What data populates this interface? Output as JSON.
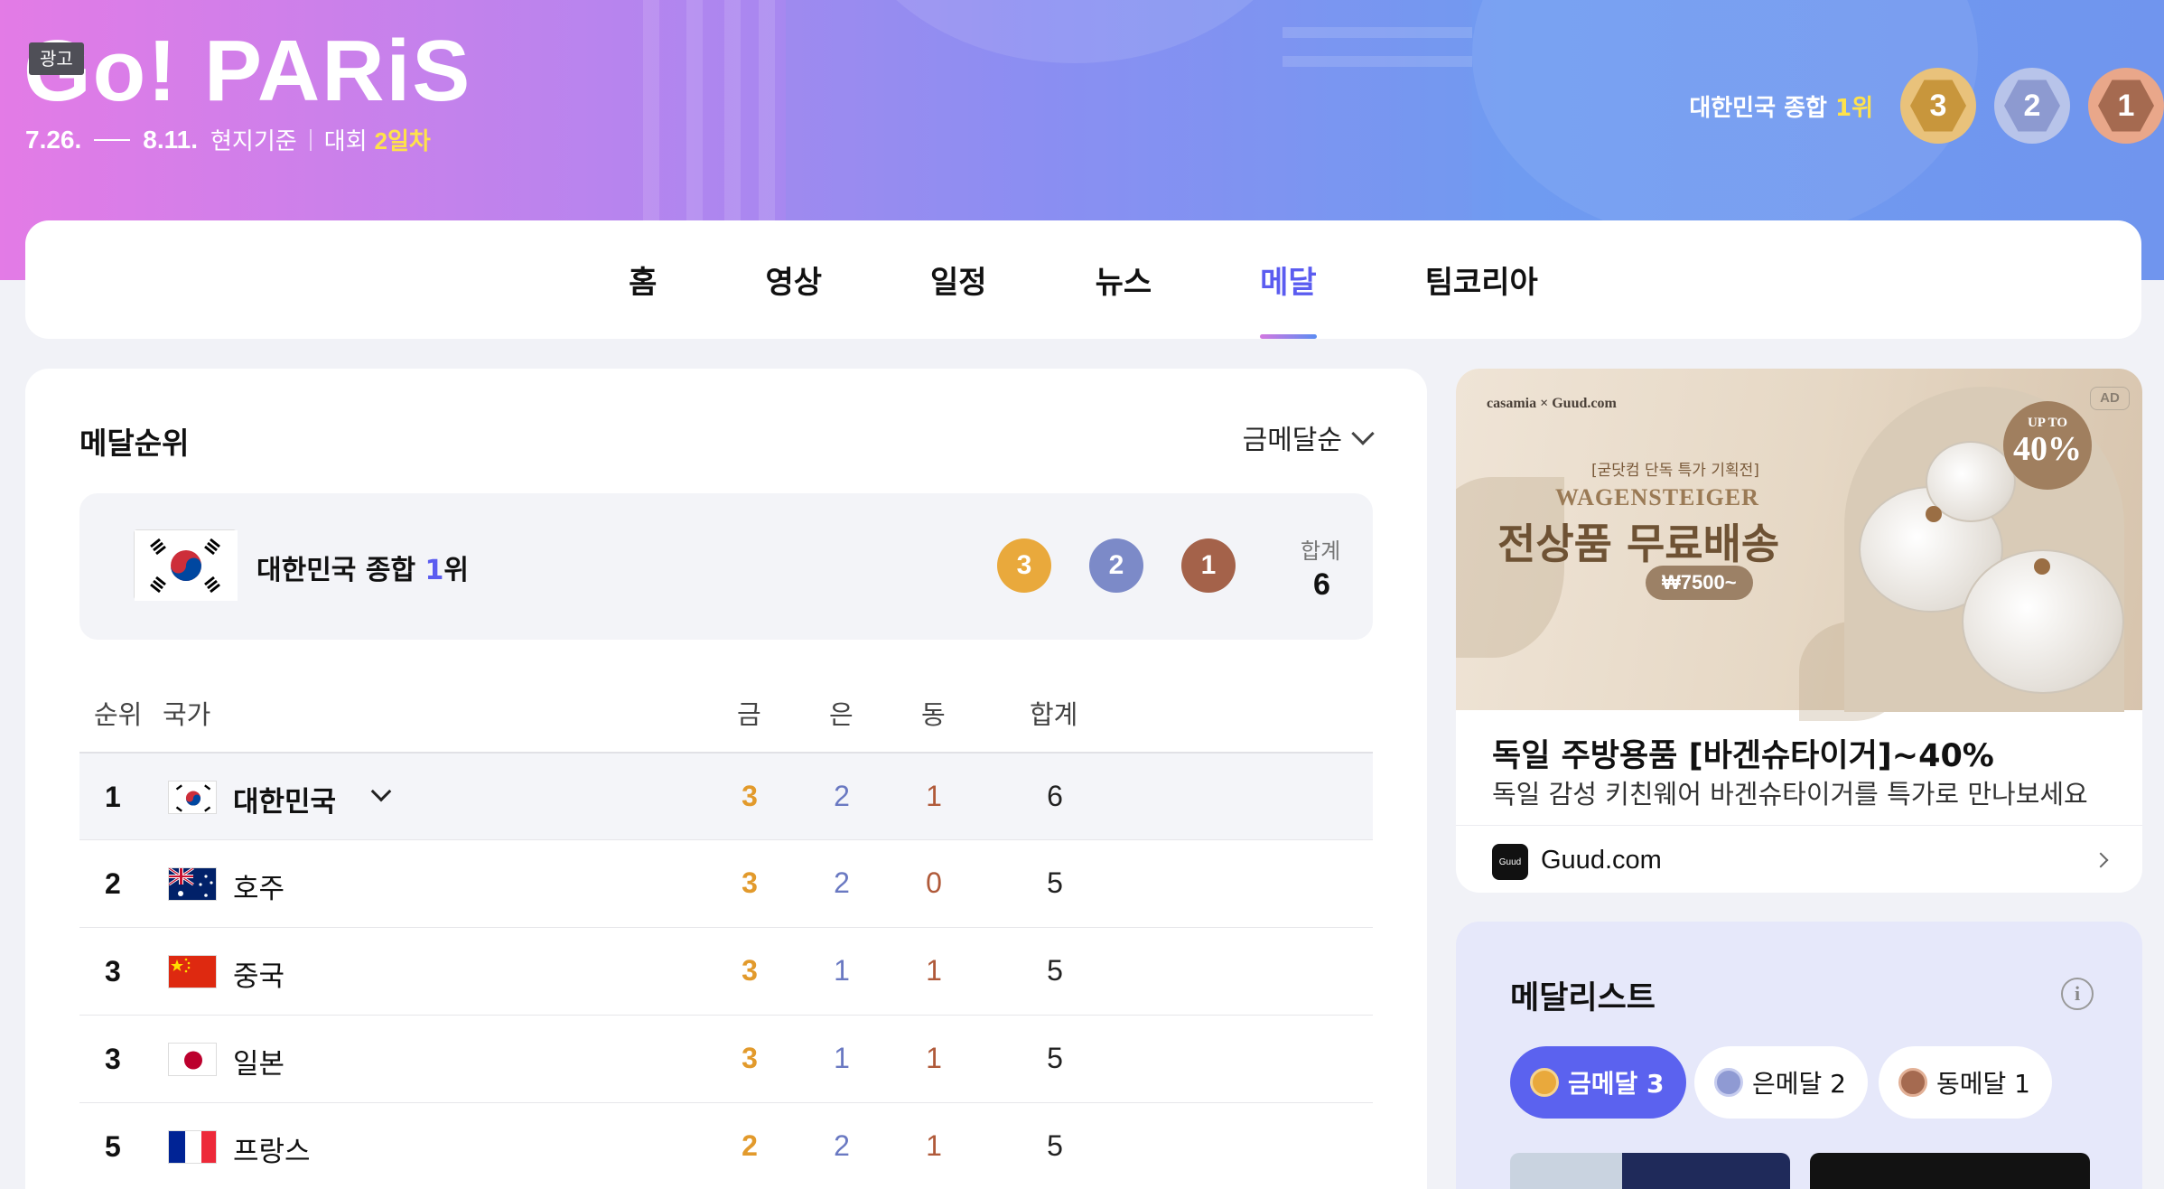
{
  "banner": {
    "ad_tag": "광고",
    "logo": "Go! PARiS",
    "date_start": "7.26.",
    "date_end": "8.11.",
    "local_time": "현지기준",
    "day_prefix": "대회",
    "day_value": "2일차",
    "rank_text_prefix": "대한민국 종합",
    "rank_text_value": "1위",
    "medals": {
      "gold": "3",
      "silver": "2",
      "bronze": "1"
    }
  },
  "nav": {
    "tabs": [
      {
        "label": "홈",
        "active": false
      },
      {
        "label": "영상",
        "active": false
      },
      {
        "label": "일정",
        "active": false
      },
      {
        "label": "뉴스",
        "active": false
      },
      {
        "label": "메달",
        "active": true
      },
      {
        "label": "팀코리아",
        "active": false
      }
    ]
  },
  "medal_table": {
    "title": "메달순위",
    "sort_label": "금메달순",
    "summary": {
      "name_prefix": "대한민국 종합 ",
      "rank_num": "1",
      "rank_suffix": "위",
      "gold": "3",
      "silver": "2",
      "bronze": "1",
      "total_label": "합계",
      "total": "6"
    },
    "headers": {
      "rank": "순위",
      "country": "국가",
      "gold": "금",
      "silver": "은",
      "bronze": "동",
      "total": "합계"
    },
    "rows": [
      {
        "rank": "1",
        "country": "대한민국",
        "flag": "kr",
        "gold": "3",
        "silver": "2",
        "bronze": "1",
        "total": "6"
      },
      {
        "rank": "2",
        "country": "호주",
        "flag": "au",
        "gold": "3",
        "silver": "2",
        "bronze": "0",
        "total": "5"
      },
      {
        "rank": "3",
        "country": "중국",
        "flag": "cn",
        "gold": "3",
        "silver": "1",
        "bronze": "1",
        "total": "5"
      },
      {
        "rank": "3",
        "country": "일본",
        "flag": "jp",
        "gold": "3",
        "silver": "1",
        "bronze": "1",
        "total": "5"
      },
      {
        "rank": "5",
        "country": "프랑스",
        "flag": "fr",
        "gold": "2",
        "silver": "2",
        "bronze": "1",
        "total": "5"
      }
    ]
  },
  "ad": {
    "brand": "casamia × Guud.com",
    "small_text": "[굳닷컴 단독 특가 기획전]",
    "wag": "WAGENSTEIGER",
    "headline_img": "전상품 무료배송",
    "price": "₩7500~",
    "sale_up": "UP TO",
    "sale_pct": "40%",
    "ad_badge": "AD",
    "title": "독일 주방용품 [바겐슈타이거]~40%",
    "desc": "독일 감성 키친웨어 바겐슈타이거를 특가로 만나보세요",
    "advertiser": "Guud.com"
  },
  "medalists": {
    "title": "메달리스트",
    "info_icon": "i",
    "filters": [
      {
        "label": "금메달 3",
        "type": "gold",
        "active": true
      },
      {
        "label": "은메달 2",
        "type": "silver",
        "active": false
      },
      {
        "label": "동메달 1",
        "type": "bronze",
        "active": false
      }
    ]
  },
  "colors": {
    "accent": "#5b5cf0",
    "gold": "#e9a93c",
    "silver": "#7c8ac8",
    "bronze": "#a4624a",
    "highlight_yellow": "#ffe24a"
  }
}
